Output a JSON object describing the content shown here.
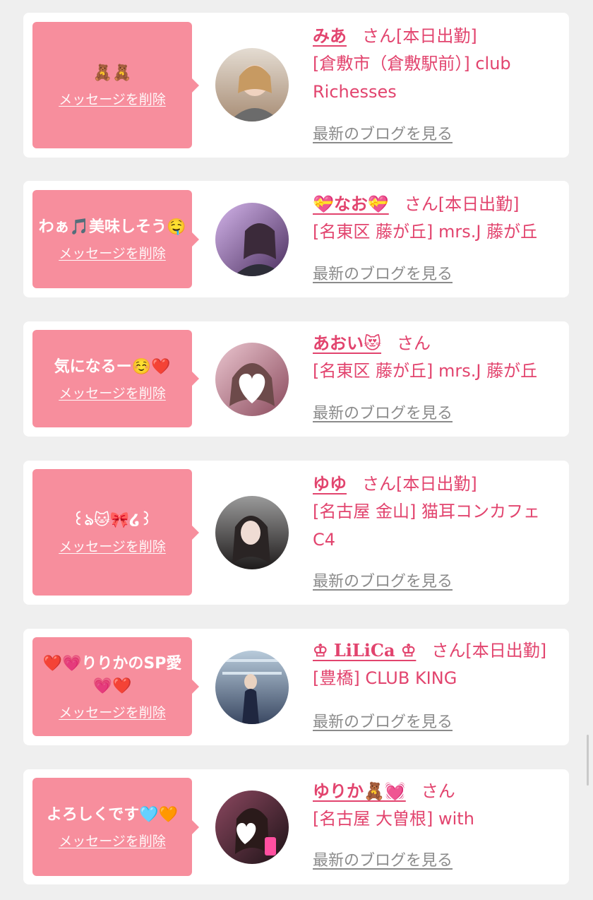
{
  "common": {
    "delete_label": "メッセージを削除",
    "blog_label": "最新のブログを見る",
    "san_suffix": "さん"
  },
  "entries": [
    {
      "message": "🧸🧸",
      "name": "みあ",
      "status": "[本日出勤]",
      "shop": "[倉敷市（倉敷駅前）] club Richesses",
      "avatar_colors": [
        "#d9cfc4",
        "#b9a48c"
      ]
    },
    {
      "message": "わぁ🎵美味しそう🤤",
      "name": "💝なお💝",
      "status": "[本日出勤]",
      "shop": "[名東区 藤が丘] mrs.J 藤が丘",
      "avatar_colors": [
        "#c9a6e0",
        "#5d3f73"
      ]
    },
    {
      "message": "気になるー☺️❤️",
      "name": "あおい😻",
      "status": "",
      "shop": "[名東区 藤が丘] mrs.J 藤が丘",
      "avatar_colors": [
        "#e7b9c4",
        "#9c5a6a"
      ]
    },
    {
      "message": "꒰ঌ🐱🎀໒꒱",
      "name": "ゆゆ",
      "status": "[本日出勤]",
      "shop": "[名古屋 金山] 猫耳コンカフェ C4",
      "avatar_colors": [
        "#8d8d8d",
        "#2b2626"
      ]
    },
    {
      "message": "❤️💗りりかのSP愛💗❤️",
      "name": "♔ LiLiCa ♔",
      "status": "[本日出勤]",
      "shop": "[豊橋] CLUB KING",
      "avatar_colors": [
        "#9fb6c9",
        "#2f3e55"
      ]
    },
    {
      "message": "よろしくです🩵🧡",
      "name": "ゆりか🧸💓",
      "status": "",
      "shop": "[名古屋 大曽根] with",
      "avatar_colors": [
        "#7a3a4f",
        "#2a1a1f"
      ]
    }
  ]
}
